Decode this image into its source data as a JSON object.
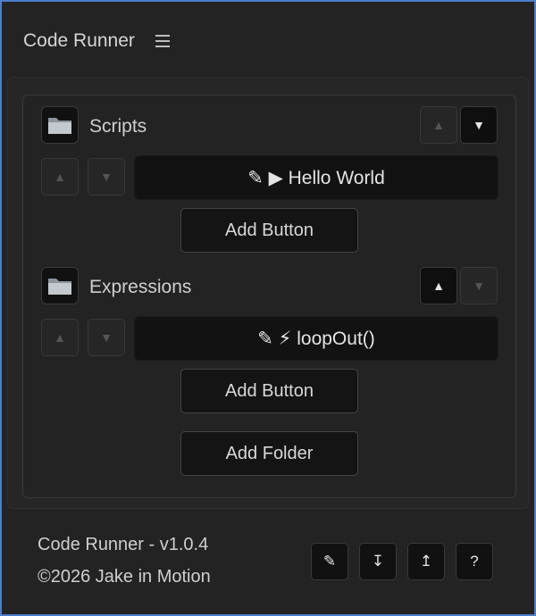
{
  "header": {
    "title": "Code Runner",
    "menu_icon": "hamburger-menu-icon"
  },
  "folders": [
    {
      "label": "Scripts",
      "icon": "folder-icon",
      "up_arrow": "▲",
      "down_arrow": "▼",
      "scripts": [
        {
          "label": "✎ ▶ Hello World"
        }
      ],
      "add_button_label": "Add Button"
    },
    {
      "label": "Expressions",
      "icon": "folder-icon",
      "up_arrow": "▲",
      "down_arrow": "▼",
      "scripts": [
        {
          "label": "✎ ⚡ loopOut()"
        }
      ],
      "add_button_label": "Add Button"
    }
  ],
  "add_folder_label": "Add Folder",
  "footer": {
    "version": "Code Runner - v1.0.4",
    "copyright": "©2026 Jake in Motion",
    "tools": [
      {
        "icon": "pencil-icon",
        "glyph": "✎"
      },
      {
        "icon": "import-icon",
        "glyph": "↧"
      },
      {
        "icon": "export-icon",
        "glyph": "↥"
      },
      {
        "icon": "help-icon",
        "glyph": "?"
      }
    ]
  }
}
